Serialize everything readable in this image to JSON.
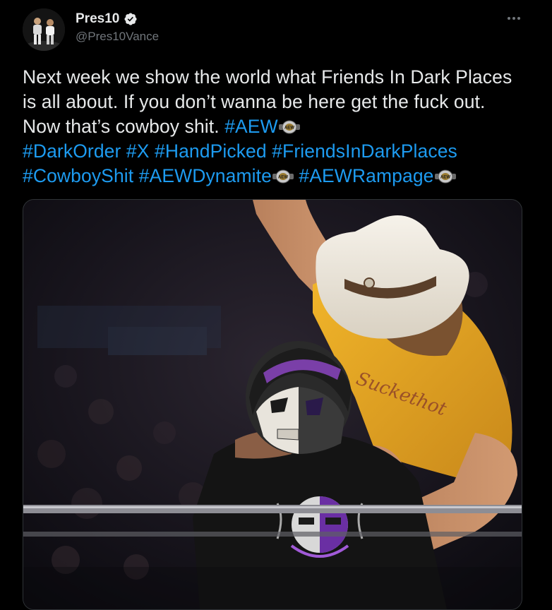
{
  "tweet": {
    "display_name": "Pres10",
    "handle": "@Pres10Vance",
    "verified": true,
    "text_parts": [
      {
        "type": "text",
        "value": "Next week we show the world what Friends In Dark Places is all about. If you don’t wanna be here get the fuck out. Now that’s cowboy shit. "
      },
      {
        "type": "hashtag",
        "value": "#AEW"
      },
      {
        "type": "hashtag",
        "value": "#DarkOrder"
      },
      {
        "type": "hashtag",
        "value": "#X"
      },
      {
        "type": "hashtag",
        "value": "#HandPicked"
      },
      {
        "type": "hashtag",
        "value": "#FriendsInDarkPlaces"
      },
      {
        "type": "hashtag",
        "value": "#CowboyShit"
      },
      {
        "type": "hashtag",
        "value": "#AEWDynamite"
      },
      {
        "type": "hashtag",
        "value": "#AEWRampage"
      }
    ]
  },
  "icons": {
    "verified": "verified-badge-icon",
    "more": "more-options-icon",
    "belt": "aew-belt-emoji-icon"
  },
  "colors": {
    "background": "#000000",
    "text": "#e7e9ea",
    "secondary": "#71767b",
    "link": "#1d9bf0",
    "shirt_yellow": "#e5a51e",
    "mask_purple": "#7a3fa8"
  }
}
